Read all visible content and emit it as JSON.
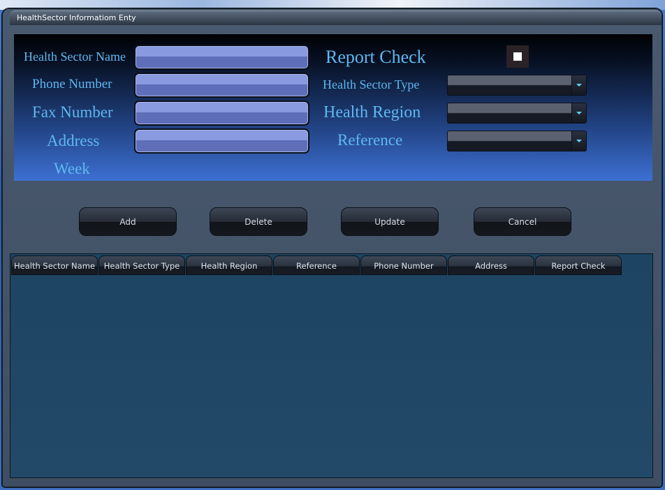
{
  "window": {
    "title": "HealthSector Informatiom Enty"
  },
  "form": {
    "labels": {
      "health_sector_name": "Health Sector Name",
      "phone_number": "Phone Number",
      "fax_number": "Fax Number",
      "address": "Address",
      "week": "Week",
      "report_check": "Report Check",
      "health_sector_type": "Health Sector Type",
      "health_region": "Health Region",
      "reference": "Reference"
    },
    "values": {
      "health_sector_name": "",
      "phone_number": "",
      "fax_number": "",
      "address": "",
      "health_sector_type": "",
      "health_region": "",
      "reference": ""
    },
    "report_check_checked": false
  },
  "buttons": {
    "add": "Add",
    "delete": "Delete",
    "update": "Update",
    "cancel": "Cancel"
  },
  "grid": {
    "columns": [
      "Health Sector Name",
      "Health Sector Type",
      "Health Region",
      "Reference",
      "Phone Number",
      "Address",
      "Report Check"
    ],
    "rows": []
  },
  "colors": {
    "label_text": "#5fb8f0",
    "accent_arrow": "#5fd0f6"
  }
}
